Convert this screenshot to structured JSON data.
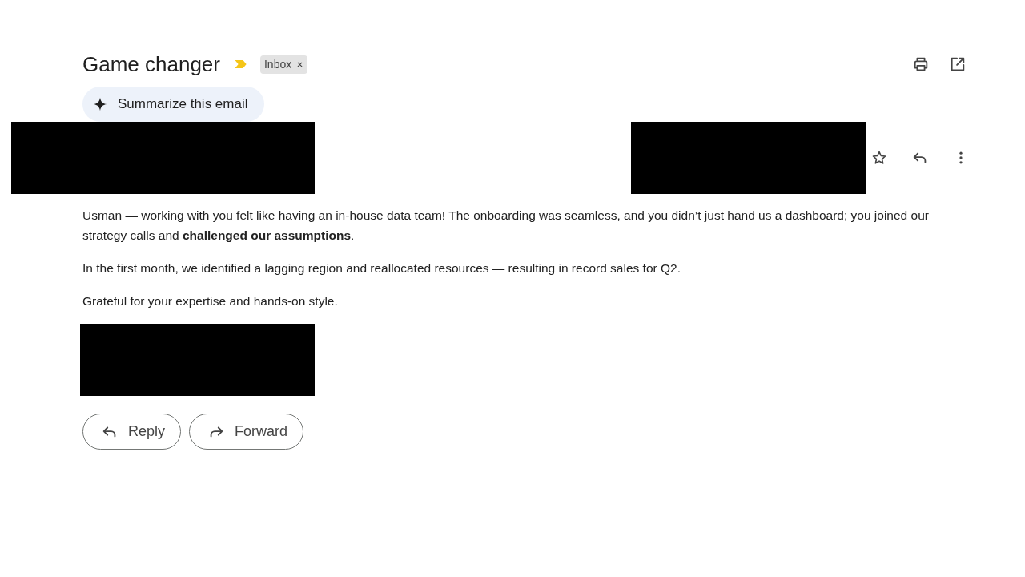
{
  "subject": "Game changer",
  "important": true,
  "labels": [
    {
      "text": "Inbox",
      "removable": true
    }
  ],
  "summarize_button": "Summarize this email",
  "sender": {
    "kind": "redacted"
  },
  "recipient_details": {
    "kind": "redacted"
  },
  "starred": false,
  "body": [
    "Usman — working with you felt like having an in-house data team! The onboarding was seamless, and you didn’t just hand us a dashboard; you joined our strategy calls and **challenged our assumptions**.",
    "In the first month, we identified a lagging region and reallocated resources — resulting in record sales for Q2.",
    "Grateful for your expertise and hands-on style."
  ],
  "signature": {
    "kind": "redacted"
  },
  "actions": [
    {
      "kind": "reply",
      "label": "Reply"
    },
    {
      "kind": "forward",
      "label": "Forward"
    }
  ]
}
